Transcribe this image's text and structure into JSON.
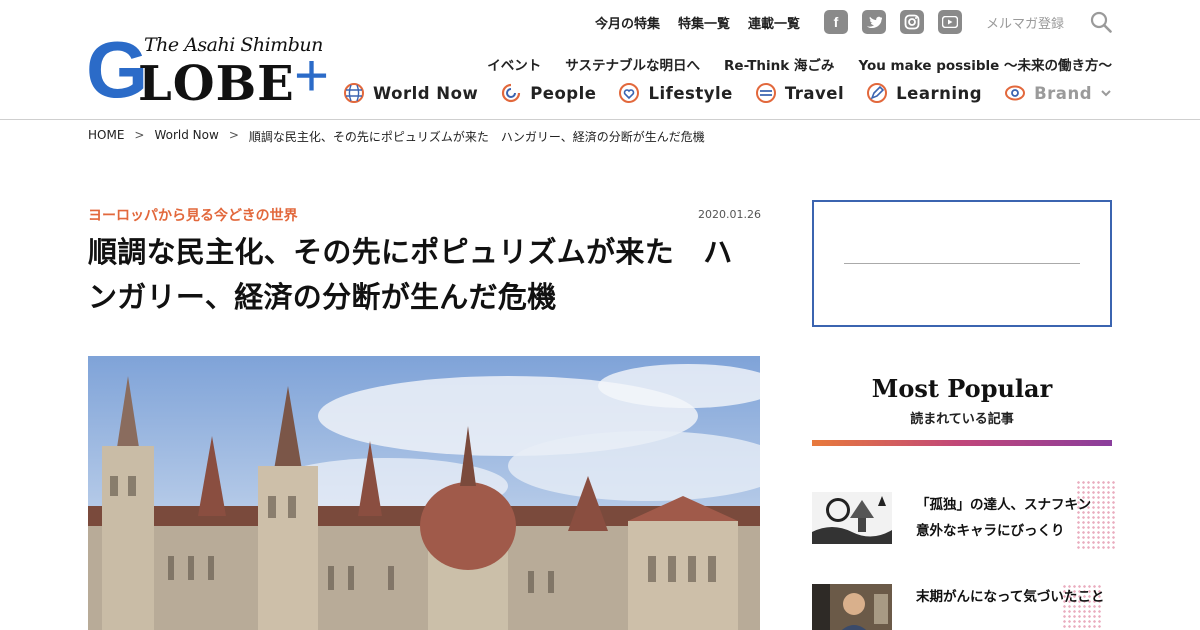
{
  "logo": {
    "tagline": "The Asahi Shimbun",
    "big": "G",
    "rest": "LOBE",
    "plus": "+"
  },
  "util_nav": {
    "links": [
      "今月の特集",
      "特集一覧",
      "連載一覧"
    ],
    "social_icons": [
      "facebook-icon",
      "twitter-icon",
      "instagram-icon",
      "youtube-icon"
    ],
    "newsletter": "メルマガ登録"
  },
  "feature_nav": [
    "イベント",
    "サステナブルな明日へ",
    "Re-Think 海ごみ",
    "You make possible ～未来の働き方～"
  ],
  "categories": [
    {
      "label": "World Now",
      "icon": "globe-icon"
    },
    {
      "label": "People",
      "icon": "people-icon"
    },
    {
      "label": "Lifestyle",
      "icon": "heart-icon"
    },
    {
      "label": "Travel",
      "icon": "travel-icon"
    },
    {
      "label": "Learning",
      "icon": "pencil-icon"
    },
    {
      "label": "Brand",
      "icon": "eye-icon"
    }
  ],
  "breadcrumb": {
    "home": "HOME",
    "section": "World Now",
    "current": "順調な民主化、その先にポピュリズムが来た　ハンガリー、経済の分断が生んだ危機",
    "sep": ">"
  },
  "article": {
    "series": "ヨーロッパから見る今どきの世界",
    "date": "2020.01.26",
    "title": "順調な民主化、その先にポピュリズムが来た　ハンガリー、経済の分断が生んだ危機"
  },
  "sidebar": {
    "popular_title": "Most Popular",
    "popular_sub": "読まれている記事",
    "items": [
      {
        "text": "「孤独」の達人、スナフキン　意外なキャラにびっくり"
      },
      {
        "text": "末期がんになって気づいたこと"
      }
    ]
  },
  "colors": {
    "brand_blue": "#2b6bc8",
    "accent_orange": "#e2683c",
    "ad_border": "#3b64b0"
  }
}
